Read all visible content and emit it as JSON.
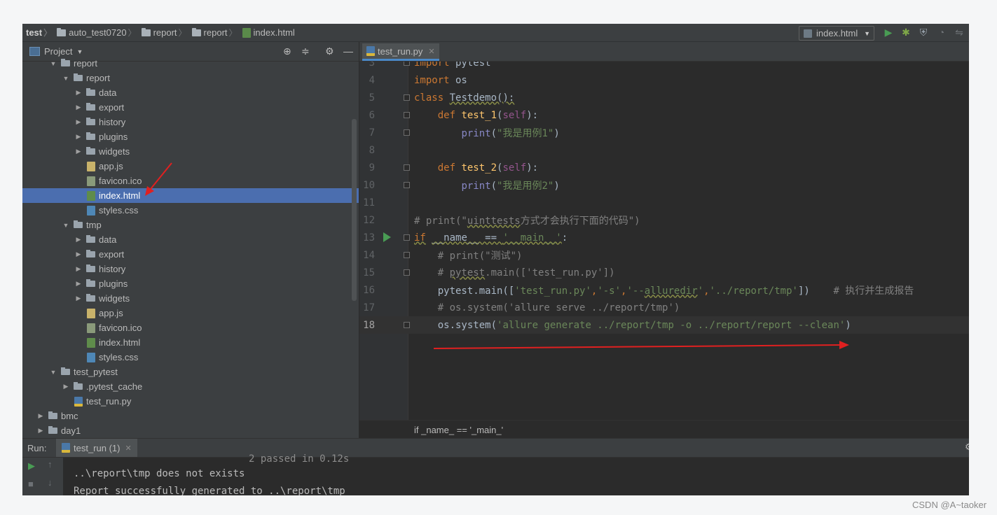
{
  "breadcrumb": [
    "test",
    "auto_test0720",
    "report",
    "report",
    "index.html"
  ],
  "toolbar": {
    "run_config": "index.html"
  },
  "project": {
    "title": "Project",
    "tree": [
      {
        "label": "report",
        "depth": 2,
        "kind": "folder",
        "open": true
      },
      {
        "label": "report",
        "depth": 3,
        "kind": "folder",
        "open": true
      },
      {
        "label": "data",
        "depth": 4,
        "kind": "folder",
        "open": false
      },
      {
        "label": "export",
        "depth": 4,
        "kind": "folder",
        "open": false
      },
      {
        "label": "history",
        "depth": 4,
        "kind": "folder",
        "open": false
      },
      {
        "label": "plugins",
        "depth": 4,
        "kind": "folder",
        "open": false
      },
      {
        "label": "widgets",
        "depth": 4,
        "kind": "folder",
        "open": false
      },
      {
        "label": "app.js",
        "depth": 4,
        "kind": "js"
      },
      {
        "label": "favicon.ico",
        "depth": 4,
        "kind": "ico"
      },
      {
        "label": "index.html",
        "depth": 4,
        "kind": "html",
        "selected": true
      },
      {
        "label": "styles.css",
        "depth": 4,
        "kind": "css"
      },
      {
        "label": "tmp",
        "depth": 3,
        "kind": "folder",
        "open": true
      },
      {
        "label": "data",
        "depth": 4,
        "kind": "folder",
        "open": false
      },
      {
        "label": "export",
        "depth": 4,
        "kind": "folder",
        "open": false
      },
      {
        "label": "history",
        "depth": 4,
        "kind": "folder",
        "open": false
      },
      {
        "label": "plugins",
        "depth": 4,
        "kind": "folder",
        "open": false
      },
      {
        "label": "widgets",
        "depth": 4,
        "kind": "folder",
        "open": false
      },
      {
        "label": "app.js",
        "depth": 4,
        "kind": "js"
      },
      {
        "label": "favicon.ico",
        "depth": 4,
        "kind": "ico"
      },
      {
        "label": "index.html",
        "depth": 4,
        "kind": "html"
      },
      {
        "label": "styles.css",
        "depth": 4,
        "kind": "css"
      },
      {
        "label": "test_pytest",
        "depth": 2,
        "kind": "folder",
        "open": true
      },
      {
        "label": ".pytest_cache",
        "depth": 3,
        "kind": "folder",
        "open": false
      },
      {
        "label": "test_run.py",
        "depth": 3,
        "kind": "py"
      },
      {
        "label": "bmc",
        "depth": 1,
        "kind": "folder",
        "open": false
      },
      {
        "label": "day1",
        "depth": 1,
        "kind": "folder",
        "open": false
      }
    ]
  },
  "editor": {
    "tab": "test_run.py",
    "lines": [
      {
        "n": "3",
        "html": "<span class=\"kw\">import</span> pytest"
      },
      {
        "n": "4",
        "html": "<span class=\"kw\">import</span> os"
      },
      {
        "n": "5",
        "html": "<span class=\"kw\">class</span> <span class=\"un\">Testdemo():</span>"
      },
      {
        "n": "6",
        "html": "    <span class=\"kw\">def</span> <span class=\"fn\">test_1</span>(<span class=\"sf\">self</span>):"
      },
      {
        "n": "7",
        "html": "        <span class=\"bi\">print</span>(<span class=\"st\">\"我是用例1\"</span>)"
      },
      {
        "n": "8",
        "html": ""
      },
      {
        "n": "9",
        "html": "    <span class=\"kw\">def</span> <span class=\"fn\">test_2</span>(<span class=\"sf\">self</span>):"
      },
      {
        "n": "10",
        "html": "        <span class=\"bi\">print</span>(<span class=\"st\">\"我是用例2\"</span>)"
      },
      {
        "n": "11",
        "html": ""
      },
      {
        "n": "12",
        "html": "<span class=\"cm\"># print(\"<span class=\"un\">uinttests</span>方式才会执行下面的代码\")</span>"
      },
      {
        "n": "13",
        "html": "<span class=\"kw un\">if</span> <span class=\"un\">__name__ == </span><span class=\"st un\">'__main__'</span>:"
      },
      {
        "n": "14",
        "html": "    <span class=\"cm\"># print(\"测试\")</span>"
      },
      {
        "n": "15",
        "html": "    <span class=\"cm\"># <span class=\"un\">pytest</span>.main(['test_run.py'])</span>"
      },
      {
        "n": "16",
        "html": "    pytest.main([<span class=\"st\">'test_run.py'</span><span class=\"kw\">,</span><span class=\"st\">'-s'</span><span class=\"kw\">,</span><span class=\"st\">'--<span class=\"un\">alluredir</span>'</span><span class=\"kw\">,</span><span class=\"st\">'../report/tmp'</span>])    <span class=\"cm\"># 执行并生成报告</span>"
      },
      {
        "n": "17",
        "html": "    <span class=\"cm\"># os.system('allure serve ../report/tmp')</span>"
      },
      {
        "n": "18",
        "html": "    os.system(<span class=\"st\">'allure generate ../report/tmp -o ../report/report --clean'</span>)"
      }
    ],
    "status_breadcrumb": "if _name_ == '_main_'"
  },
  "run": {
    "label": "Run:",
    "tab": "test_run (1)",
    "output": [
      "2 passed in 0.12s",
      "..\\report\\tmp does not exists",
      "Report successfully generated to ..\\report\\tmp"
    ]
  },
  "watermark": "CSDN @A~taoker",
  "colors": {
    "background": "#2b2b2b",
    "panel": "#3c3f41",
    "selection": "#4b6eaf",
    "keyword": "#cc7832",
    "string": "#6a8759",
    "annotation_arrow": "#e02020"
  }
}
